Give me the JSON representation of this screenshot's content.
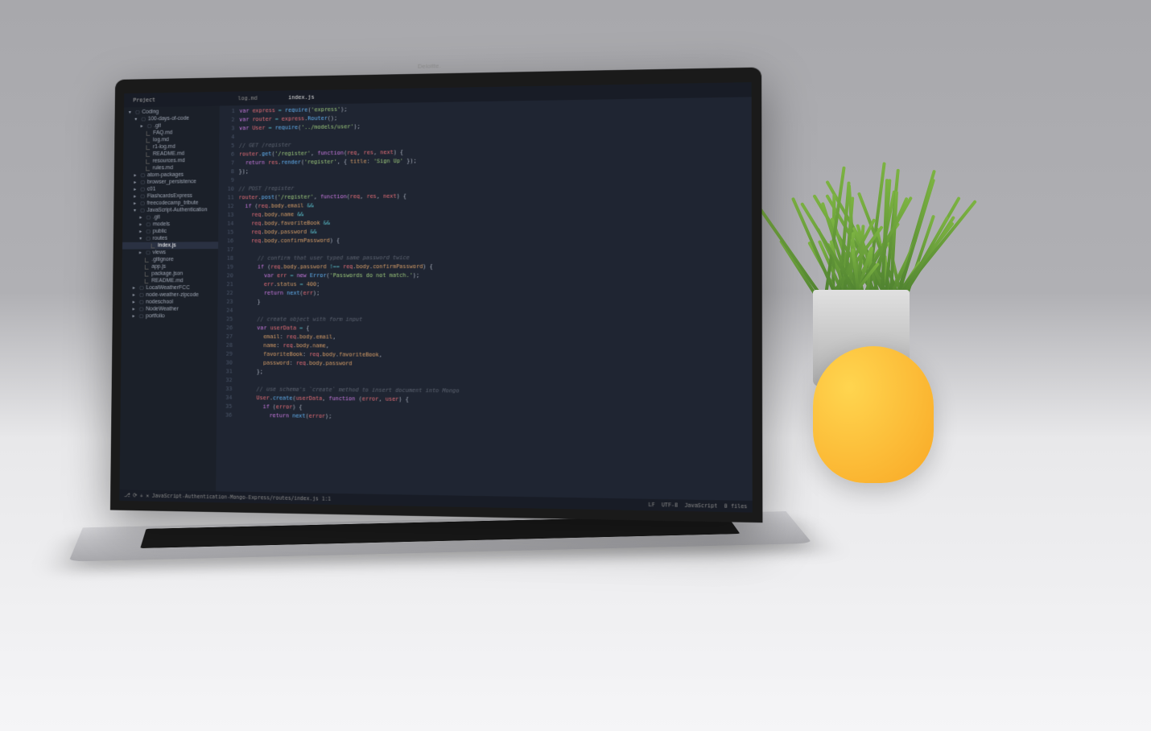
{
  "laptop_brand": "Deloitte.",
  "sidebar": {
    "header": "Project",
    "tree": [
      {
        "label": "Coding",
        "depth": 0,
        "icon": "▾",
        "type": "folder"
      },
      {
        "label": "100-days-of-code",
        "depth": 1,
        "icon": "▾",
        "type": "folder"
      },
      {
        "label": ".git",
        "depth": 2,
        "icon": "▸",
        "type": "folder"
      },
      {
        "label": "FAQ.md",
        "depth": 2,
        "icon": "📄",
        "type": "file"
      },
      {
        "label": "log.md",
        "depth": 2,
        "icon": "📄",
        "type": "file"
      },
      {
        "label": "r1-log.md",
        "depth": 2,
        "icon": "📄",
        "type": "file"
      },
      {
        "label": "README.md",
        "depth": 2,
        "icon": "📄",
        "type": "file"
      },
      {
        "label": "resources.md",
        "depth": 2,
        "icon": "📄",
        "type": "file"
      },
      {
        "label": "rules.md",
        "depth": 2,
        "icon": "📄",
        "type": "file"
      },
      {
        "label": "atom-packages",
        "depth": 1,
        "icon": "▸",
        "type": "folder"
      },
      {
        "label": "browser_persistence",
        "depth": 1,
        "icon": "▸",
        "type": "folder"
      },
      {
        "label": "c01",
        "depth": 1,
        "icon": "▸",
        "type": "folder"
      },
      {
        "label": "FlashcardsExpress",
        "depth": 1,
        "icon": "▸",
        "type": "folder"
      },
      {
        "label": "freecodecamp_tribute",
        "depth": 1,
        "icon": "▸",
        "type": "folder"
      },
      {
        "label": "JavaScript-Authentication",
        "depth": 1,
        "icon": "▾",
        "type": "folder"
      },
      {
        "label": ".git",
        "depth": 2,
        "icon": "▸",
        "type": "folder"
      },
      {
        "label": "models",
        "depth": 2,
        "icon": "▸",
        "type": "folder"
      },
      {
        "label": "public",
        "depth": 2,
        "icon": "▸",
        "type": "folder"
      },
      {
        "label": "routes",
        "depth": 2,
        "icon": "▾",
        "type": "folder"
      },
      {
        "label": "index.js",
        "depth": 3,
        "icon": "📄",
        "type": "file",
        "selected": true
      },
      {
        "label": "views",
        "depth": 2,
        "icon": "▸",
        "type": "folder"
      },
      {
        "label": ".gitignore",
        "depth": 2,
        "icon": "📄",
        "type": "file"
      },
      {
        "label": "app.js",
        "depth": 2,
        "icon": "📄",
        "type": "file"
      },
      {
        "label": "package.json",
        "depth": 2,
        "icon": "📄",
        "type": "file"
      },
      {
        "label": "README.md",
        "depth": 2,
        "icon": "📄",
        "type": "file"
      },
      {
        "label": "LocalWeatherFCC",
        "depth": 1,
        "icon": "▸",
        "type": "folder"
      },
      {
        "label": "node-weather-zipcode",
        "depth": 1,
        "icon": "▸",
        "type": "folder"
      },
      {
        "label": "nodeschool",
        "depth": 1,
        "icon": "▸",
        "type": "folder"
      },
      {
        "label": "NodeWeather",
        "depth": 1,
        "icon": "▸",
        "type": "folder"
      },
      {
        "label": "portfolio",
        "depth": 1,
        "icon": "▸",
        "type": "folder"
      }
    ]
  },
  "tabs": [
    {
      "label": "log.md",
      "active": false
    },
    {
      "label": "index.js",
      "active": true
    }
  ],
  "code_lines": [
    {
      "n": 1,
      "html": "<span class='kw'>var</span> <span class='var'>express</span> <span class='op'>=</span> <span class='fn'>require</span>(<span class='str'>'express'</span>);"
    },
    {
      "n": 2,
      "html": "<span class='kw'>var</span> <span class='var'>router</span> <span class='op'>=</span> <span class='var'>express</span>.<span class='fn'>Router</span>();"
    },
    {
      "n": 3,
      "html": "<span class='kw'>var</span> <span class='var'>User</span> <span class='op'>=</span> <span class='fn'>require</span>(<span class='str'>'../models/user'</span>);"
    },
    {
      "n": 4,
      "html": ""
    },
    {
      "n": 5,
      "html": "<span class='cm'>// GET /register</span>"
    },
    {
      "n": 6,
      "html": "<span class='var'>router</span>.<span class='fn'>get</span>(<span class='str'>'/register'</span>, <span class='kw'>function</span>(<span class='var'>req</span>, <span class='var'>res</span>, <span class='var'>next</span>) {"
    },
    {
      "n": 7,
      "html": "  <span class='kw'>return</span> <span class='var'>res</span>.<span class='fn'>render</span>(<span class='str'>'register'</span>, { <span class='prop'>title</span>: <span class='str'>'Sign Up'</span> });"
    },
    {
      "n": 8,
      "html": "});"
    },
    {
      "n": 9,
      "html": ""
    },
    {
      "n": 10,
      "html": "<span class='cm'>// POST /register</span>"
    },
    {
      "n": 11,
      "html": "<span class='var'>router</span>.<span class='fn'>post</span>(<span class='str'>'/register'</span>, <span class='kw'>function</span>(<span class='var'>req</span>, <span class='var'>res</span>, <span class='var'>next</span>) {"
    },
    {
      "n": 12,
      "html": "  <span class='kw'>if</span> (<span class='req'>req</span>.<span class='prop'>body</span>.<span class='prop'>email</span> <span class='op'>&amp;&amp;</span>"
    },
    {
      "n": 13,
      "html": "    <span class='req'>req</span>.<span class='prop'>body</span>.<span class='prop'>name</span> <span class='op'>&amp;&amp;</span>"
    },
    {
      "n": 14,
      "html": "    <span class='req'>req</span>.<span class='prop'>body</span>.<span class='prop'>favoriteBook</span> <span class='op'>&amp;&amp;</span>"
    },
    {
      "n": 15,
      "html": "    <span class='req'>req</span>.<span class='prop'>body</span>.<span class='prop'>password</span> <span class='op'>&amp;&amp;</span>"
    },
    {
      "n": 16,
      "html": "    <span class='req'>req</span>.<span class='prop'>body</span>.<span class='prop'>confirmPassword</span>) {"
    },
    {
      "n": 17,
      "html": ""
    },
    {
      "n": 18,
      "html": "      <span class='cm'>// confirm that user typed same password twice</span>"
    },
    {
      "n": 19,
      "html": "      <span class='kw'>if</span> (<span class='req'>req</span>.<span class='prop'>body</span>.<span class='prop'>password</span> <span class='op'>!==</span> <span class='req'>req</span>.<span class='prop'>body</span>.<span class='prop'>confirmPassword</span>) {"
    },
    {
      "n": 20,
      "html": "        <span class='kw'>var</span> <span class='var'>err</span> <span class='op'>=</span> <span class='kw'>new</span> <span class='fn'>Error</span>(<span class='str'>'Passwords do not match.'</span>);"
    },
    {
      "n": 21,
      "html": "        <span class='var'>err</span>.<span class='prop'>status</span> <span class='op'>=</span> <span class='num'>400</span>;"
    },
    {
      "n": 22,
      "html": "        <span class='kw'>return</span> <span class='fn'>next</span>(<span class='var'>err</span>);"
    },
    {
      "n": 23,
      "html": "      }"
    },
    {
      "n": 24,
      "html": ""
    },
    {
      "n": 25,
      "html": "      <span class='cm'>// create object with form input</span>"
    },
    {
      "n": 26,
      "html": "      <span class='kw'>var</span> <span class='var'>userData</span> <span class='op'>=</span> {"
    },
    {
      "n": 27,
      "html": "        <span class='prop'>email</span>: <span class='req'>req</span>.<span class='prop'>body</span>.<span class='prop'>email</span>,"
    },
    {
      "n": 28,
      "html": "        <span class='prop'>name</span>: <span class='req'>req</span>.<span class='prop'>body</span>.<span class='prop'>name</span>,"
    },
    {
      "n": 29,
      "html": "        <span class='prop'>favoriteBook</span>: <span class='req'>req</span>.<span class='prop'>body</span>.<span class='prop'>favoriteBook</span>,"
    },
    {
      "n": 30,
      "html": "        <span class='prop'>password</span>: <span class='req'>req</span>.<span class='prop'>body</span>.<span class='prop'>password</span>"
    },
    {
      "n": 31,
      "html": "      };"
    },
    {
      "n": 32,
      "html": ""
    },
    {
      "n": 33,
      "html": "      <span class='cm'>// use schema's `create` method to insert document into Mongo</span>"
    },
    {
      "n": 34,
      "html": "      <span class='var'>User</span>.<span class='fn'>create</span>(<span class='var'>userData</span>, <span class='kw'>function</span> (<span class='var'>error</span>, <span class='var'>user</span>) {"
    },
    {
      "n": 35,
      "html": "        <span class='kw'>if</span> (<span class='var'>error</span>) {"
    },
    {
      "n": 36,
      "html": "          <span class='kw'>return</span> <span class='fn'>next</span>(<span class='var'>error</span>);"
    }
  ],
  "status": {
    "path": "JavaScript-Authentication-Mongo-Express/routes/index.js",
    "position": "1:1",
    "line_ending": "LF",
    "encoding": "UTF-8",
    "language": "JavaScript",
    "files": "0 files"
  }
}
